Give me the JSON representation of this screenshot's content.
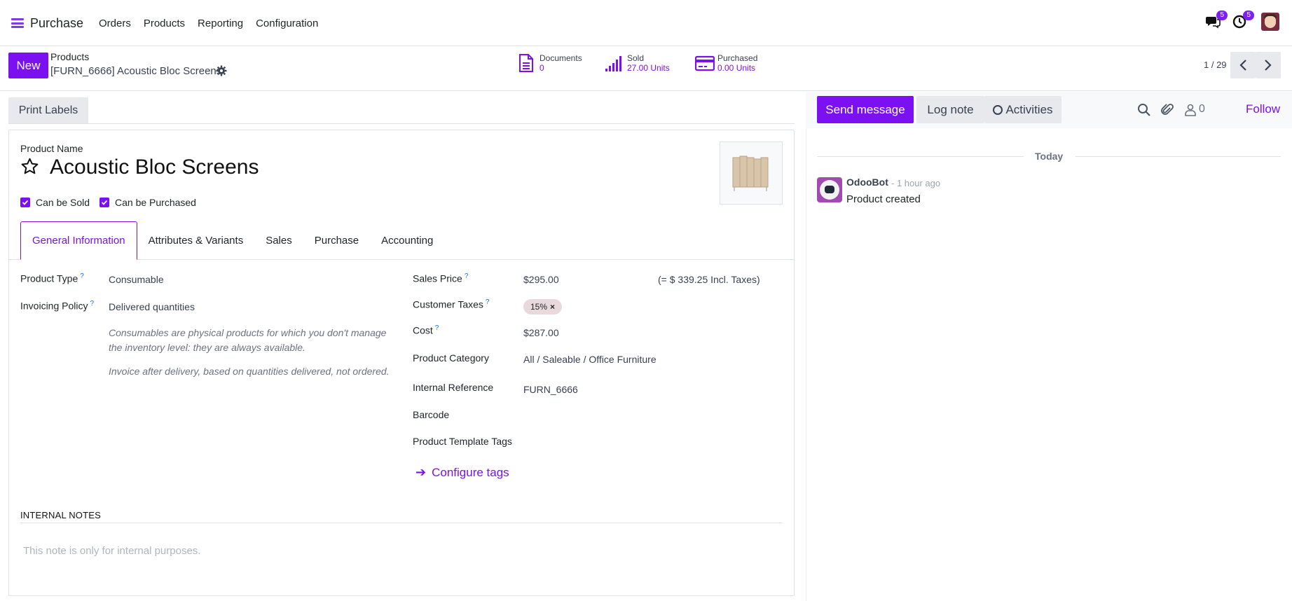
{
  "nav": {
    "app_name": "Purchase",
    "menu": [
      "Orders",
      "Products",
      "Reporting",
      "Configuration"
    ],
    "messages_badge": "5",
    "activities_badge": "5"
  },
  "control": {
    "new_label": "New",
    "breadcrumb_parent": "Products",
    "breadcrumb_current": "[FURN_6666] Acoustic Bloc Screens",
    "smart_buttons": [
      {
        "label": "Documents",
        "value": "0",
        "icon": "document-icon"
      },
      {
        "label": "Sold",
        "value": "27.00 Units",
        "icon": "signal-icon"
      },
      {
        "label": "Purchased",
        "value": "0.00 Units",
        "icon": "credit-card-icon"
      }
    ],
    "pager": "1 / 29"
  },
  "form": {
    "print_labels": "Print Labels",
    "product_name_label": "Product Name",
    "product_name": "Acoustic Bloc Screens",
    "can_be_sold": "Can be Sold",
    "can_be_purchased": "Can be Purchased",
    "tabs": [
      "General Information",
      "Attributes & Variants",
      "Sales",
      "Purchase",
      "Accounting"
    ],
    "active_tab": "General Information",
    "left": {
      "product_type_label": "Product Type",
      "product_type": "Consumable",
      "invoicing_policy_label": "Invoicing Policy",
      "invoicing_policy": "Delivered quantities",
      "help_consumable_1": "Consumables are physical products for which you don't manage",
      "help_consumable_2": "the inventory level: they are always available.",
      "help_invoice": "Invoice after delivery, based on quantities delivered, not ordered."
    },
    "right": {
      "sales_price_label": "Sales Price",
      "sales_price": "$295.00",
      "incl_taxes": "(= $ 339.25 Incl. Taxes)",
      "customer_taxes_label": "Customer Taxes",
      "customer_tax_tag": "15%",
      "cost_label": "Cost",
      "cost": "$287.00",
      "category_label": "Product Category",
      "category": "All / Saleable / Office Furniture",
      "internal_ref_label": "Internal Reference",
      "internal_ref": "FURN_6666",
      "barcode_label": "Barcode",
      "template_tags_label": "Product Template Tags",
      "configure_tags": "Configure tags"
    },
    "internal_notes_heading": "INTERNAL NOTES",
    "internal_notes_placeholder": "This note is only for internal purposes."
  },
  "chatter": {
    "send_message": "Send message",
    "log_note": "Log note",
    "activities": "Activities",
    "followers_count": "0",
    "follow": "Follow",
    "today": "Today",
    "messages": [
      {
        "author": "OdooBot",
        "time": "- 1 hour ago",
        "body": "Product created"
      }
    ]
  },
  "colors": {
    "accent": "#7b10f0",
    "button_secondary": "#e7e9ed"
  }
}
